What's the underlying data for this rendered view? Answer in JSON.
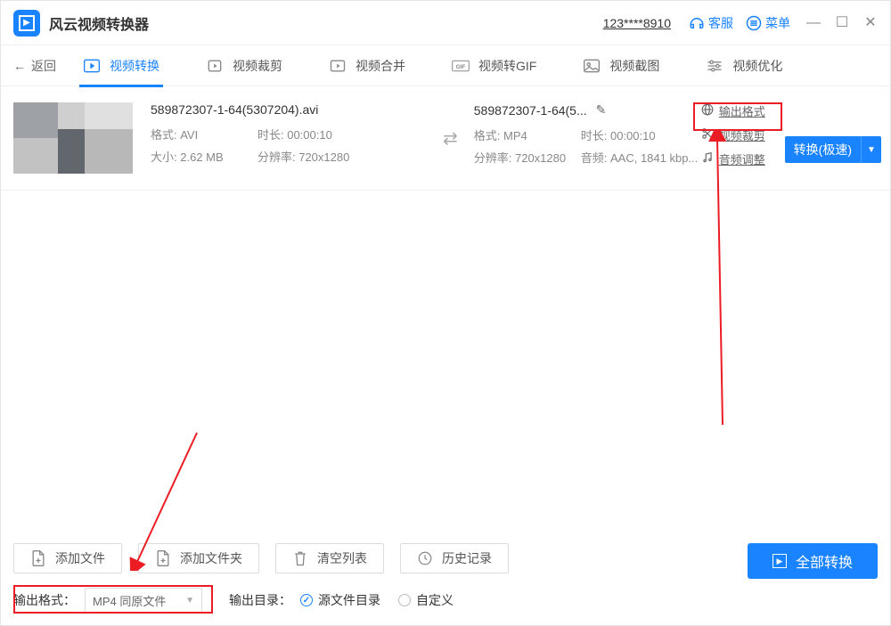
{
  "app": {
    "title": "风云视频转换器"
  },
  "header": {
    "phone": "123****8910",
    "support": "客服",
    "menu": "菜单"
  },
  "back": "返回",
  "tabs": [
    {
      "label": "视频转换",
      "active": true
    },
    {
      "label": "视频裁剪"
    },
    {
      "label": "视频合并"
    },
    {
      "label": "视频转GIF"
    },
    {
      "label": "视频截图"
    },
    {
      "label": "视频优化"
    }
  ],
  "file": {
    "src": {
      "name": "589872307-1-64(5307204).avi",
      "format_label": "格式: AVI",
      "duration_label": "时长: 00:00:10",
      "size_label": "大小: 2.62 MB",
      "resolution_label": "分辨率: 720x1280"
    },
    "dst": {
      "name": "589872307-1-64(5...",
      "format_label": "格式: MP4",
      "duration_label": "时长: 00:00:10",
      "resolution_label": "分辨率: 720x1280",
      "audio_label": "音频: AAC, 1841 kbp..."
    },
    "actions": {
      "out_format": "输出格式",
      "crop": "视频裁剪",
      "audio": "音频调整"
    },
    "convert_btn": "转换(极速)"
  },
  "bottom": {
    "add_file": "添加文件",
    "add_folder": "添加文件夹",
    "clear": "清空列表",
    "history": "历史记录",
    "convert_all": "全部转换",
    "out_fmt_label": "输出格式：",
    "out_fmt_value": "MP4 同原文件",
    "out_dir_label": "输出目录：",
    "radio_src": "源文件目录",
    "radio_custom": "自定义"
  }
}
